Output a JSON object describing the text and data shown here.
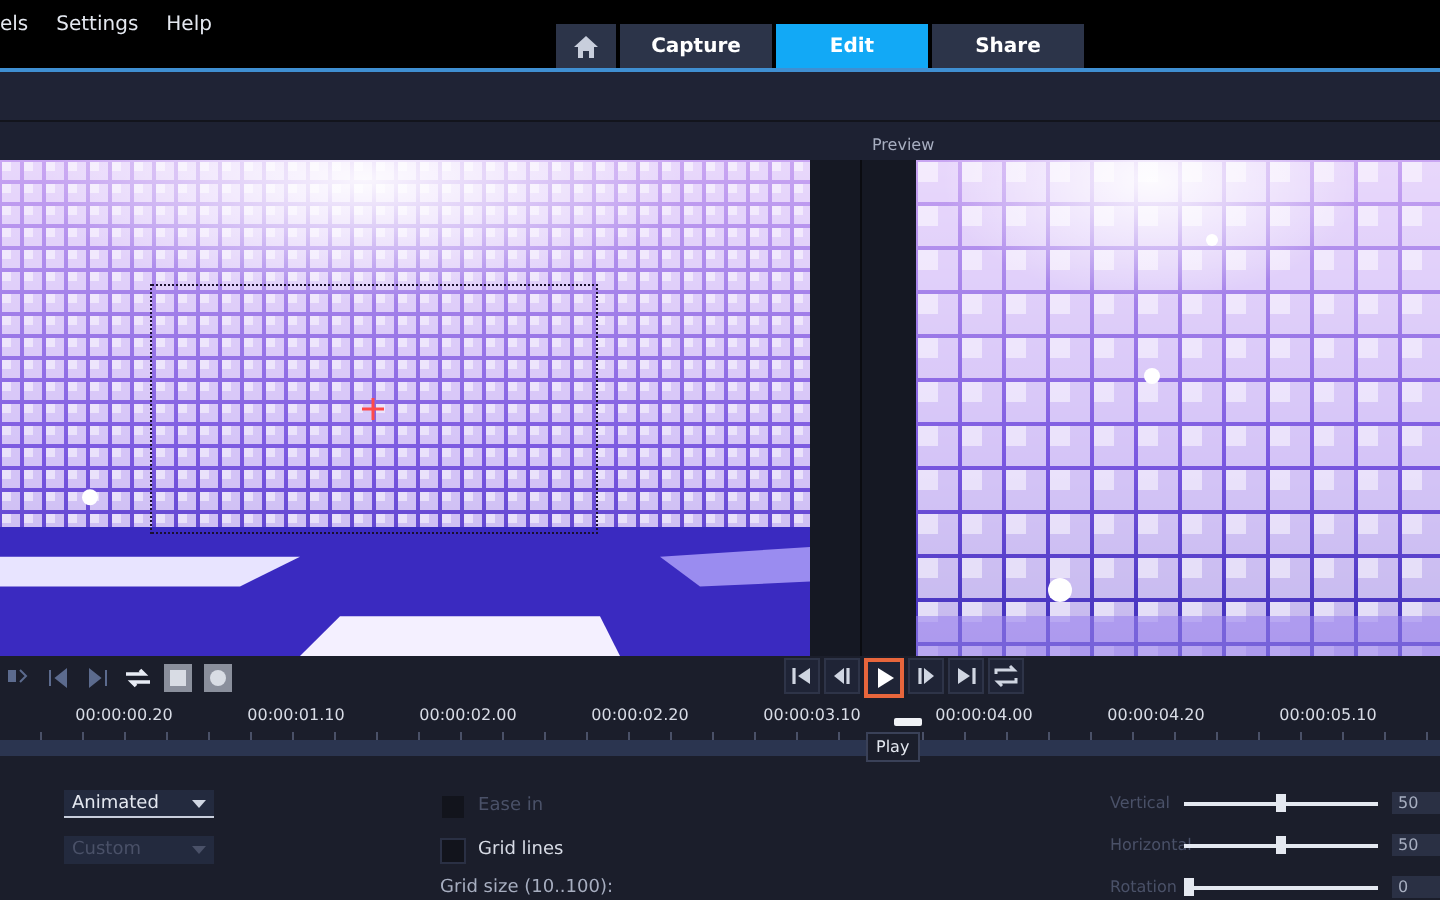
{
  "menu": [
    {
      "label": "els"
    },
    {
      "label": "Settings"
    },
    {
      "label": "Help"
    }
  ],
  "tabs": [
    {
      "kind": "home",
      "selected": false
    },
    {
      "kind": "text",
      "label": "Capture",
      "selected": false
    },
    {
      "kind": "text",
      "label": "Edit",
      "selected": true
    },
    {
      "kind": "text",
      "label": "Share",
      "selected": false
    }
  ],
  "preview_label": "Preview",
  "playback_buttons": [
    {
      "kind": "start",
      "focused": false
    },
    {
      "kind": "prev",
      "focused": false
    },
    {
      "kind": "play",
      "focused": true
    },
    {
      "kind": "next",
      "focused": false
    },
    {
      "kind": "end",
      "focused": false
    },
    {
      "kind": "repeat",
      "focused": false
    }
  ],
  "tooltip": "Play",
  "timecodes": [
    "00:00:00.20",
    "00:00:01.10",
    "00:00:02.00",
    "00:00:02.20",
    "00:00:03.10",
    "00:00:04.00",
    "00:00:04.20",
    "00:00:05.10"
  ],
  "dropdowns": [
    {
      "value": "Animated",
      "disabled": false
    },
    {
      "value": "Custom",
      "disabled": true
    }
  ],
  "checkboxes": [
    {
      "label": "Ease in",
      "checked": false,
      "disabled": true
    },
    {
      "label": "Grid lines",
      "checked": false,
      "disabled": false
    }
  ],
  "grid_size_label": "Grid size (10..100):",
  "sliders": [
    {
      "label": "Vertical",
      "level": 0.5,
      "reading": "50"
    },
    {
      "label": "Horizontal",
      "level": 0.5,
      "reading": "50"
    },
    {
      "label": "Rotation",
      "level": 0,
      "reading": "0"
    }
  ]
}
